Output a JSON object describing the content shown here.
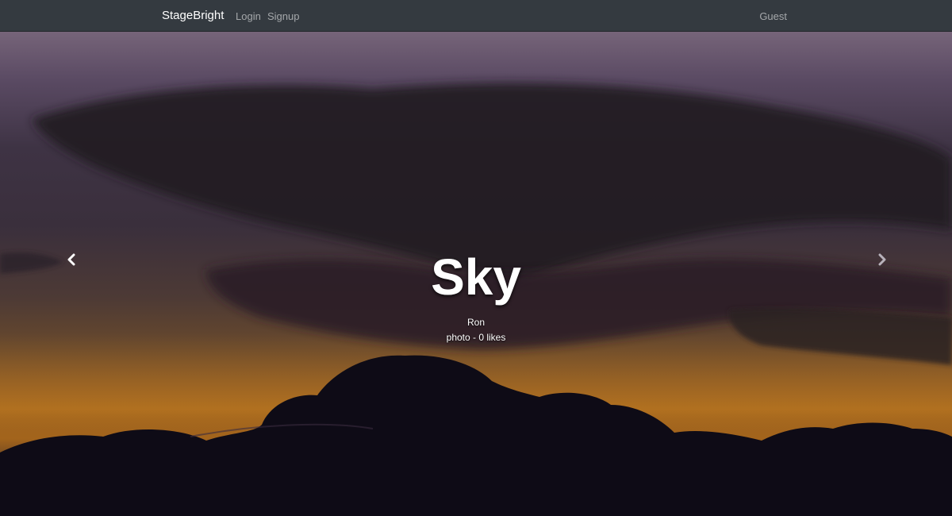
{
  "navbar": {
    "brand": "StageBright",
    "links": [
      {
        "label": "Login"
      },
      {
        "label": "Signup"
      }
    ],
    "user": "Guest"
  },
  "carousel": {
    "slide": {
      "title": "Sky",
      "author": "Ron",
      "meta": "photo - 0 likes"
    },
    "controls": {
      "prev_icon": "chevron-left-icon",
      "next_icon": "chevron-right-icon"
    }
  },
  "colors": {
    "navbar_bg": "#343a40",
    "brand": "#ffffff",
    "nav_link": "rgba(255,255,255,0.55)"
  }
}
